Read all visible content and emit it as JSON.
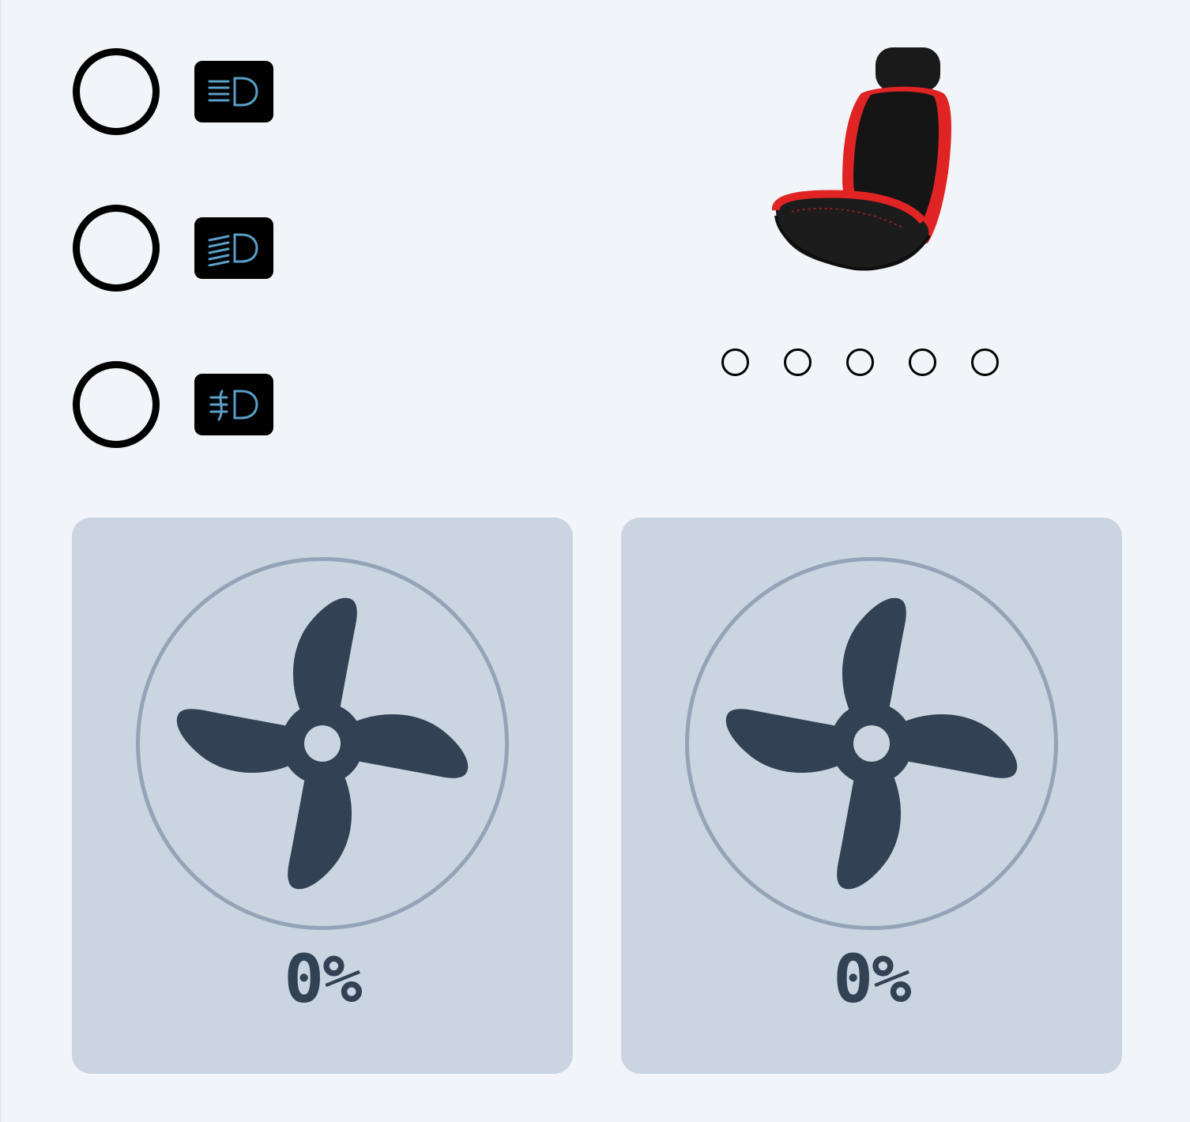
{
  "lights": [
    {
      "name": "low-beam",
      "icon": "low-beam-headlight-icon",
      "on": false
    },
    {
      "name": "high-beam",
      "icon": "high-beam-headlight-icon",
      "on": false
    },
    {
      "name": "fog",
      "icon": "fog-light-icon",
      "on": false
    }
  ],
  "seat": {
    "icon": "car-seat-icon",
    "levels": 5,
    "active_level": 0
  },
  "fans": [
    {
      "icon": "fan-icon",
      "value_text": "0%"
    },
    {
      "icon": "fan-icon",
      "value_text": "0%"
    }
  ],
  "colors": {
    "background": "#f1f5f9",
    "card": "#cbd5e1",
    "ring": "#94a3b8",
    "fan": "#334155",
    "headlight_glyph": "#5aa0c8",
    "seat_accent": "#e02424"
  }
}
